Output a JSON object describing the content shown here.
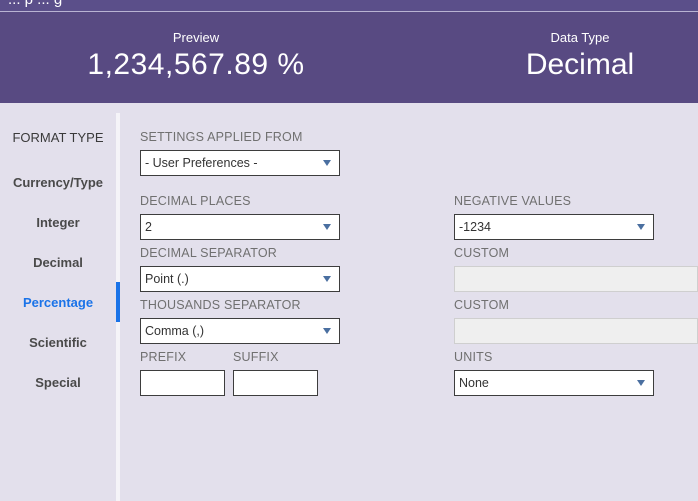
{
  "topbar": {
    "title": "... p ... g"
  },
  "header": {
    "preview_label": "Preview",
    "preview_value": "1,234,567.89 %",
    "dtype_label": "Data Type",
    "dtype_value": "Decimal"
  },
  "sidebar": {
    "header": "FORMAT TYPE",
    "items": [
      {
        "label": "Currency/Type"
      },
      {
        "label": "Integer"
      },
      {
        "label": "Decimal"
      },
      {
        "label": "Percentage"
      },
      {
        "label": "Scientific"
      },
      {
        "label": "Special"
      }
    ],
    "active": "Percentage"
  },
  "form": {
    "settings_label": "SETTINGS APPLIED FROM",
    "settings_value": "- User Preferences -",
    "decimal_places_label": "DECIMAL PLACES",
    "decimal_places_value": "2",
    "negative_label": "NEGATIVE VALUES",
    "negative_value": "-1234",
    "decimal_sep_label": "DECIMAL SEPARATOR",
    "decimal_sep_value": "Point (.)",
    "custom_label_1": "CUSTOM",
    "thousands_sep_label": "THOUSANDS SEPARATOR",
    "thousands_sep_value": "Comma (,)",
    "custom_label_2": "CUSTOM",
    "prefix_label": "PREFIX",
    "suffix_label": "SUFFIX",
    "units_label": "UNITS",
    "units_value": "None"
  },
  "colors": {
    "header_bg": "#584a82",
    "accent": "#1a73e8",
    "page_bg": "#e3e0ec"
  }
}
